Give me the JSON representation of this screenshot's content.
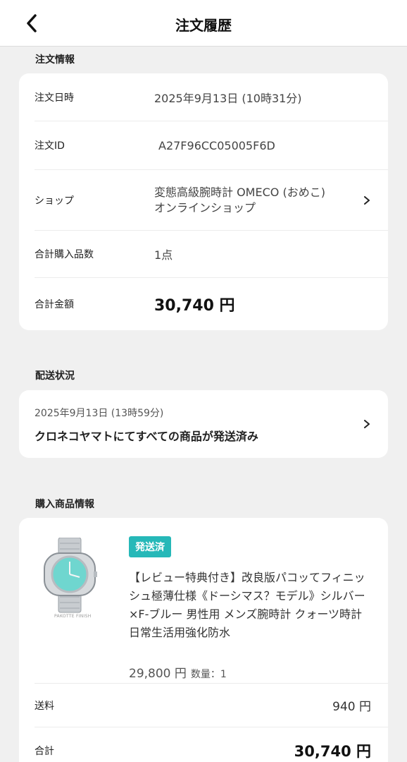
{
  "header": {
    "title": "注文履歴",
    "back_icon": "chevron-left-icon"
  },
  "order_info": {
    "section_label": "注文情報",
    "date_label": "注文日時",
    "date_value": "2025年9月13日 (10時31分)",
    "id_label": "注文ID",
    "id_value": "A27F96CC05005F6D",
    "shop_label": "ショップ",
    "shop_line1": "変態高級腕時計 OMECO (おめこ)",
    "shop_line2": "オンラインショップ",
    "count_label": "合計購入品数",
    "count_value": "1点",
    "total_label": "合計金額",
    "total_value": "30,740 円"
  },
  "shipping": {
    "section_label": "配送状況",
    "date": "2025年9月13日 (13時59分)",
    "message": "クロネコヤマトにてすべての商品が発送済み"
  },
  "products": {
    "section_label": "購入商品情報",
    "badge": "発送済",
    "name": "【レビュー特典付き】改良版パコッてフィニッシュ極薄仕様《ドーシマス？モデル》シルバー×F-ブルー 男性用 メンズ腕時計 クォーツ時計 日常生活用強化防水",
    "price": "29,800 円",
    "qty": "数量：1",
    "image_watermark": "PAKOTTE FINISH",
    "shipping_label": "送料",
    "shipping_value": "940 円",
    "total_label": "合計",
    "total_value": "30,740 円"
  }
}
